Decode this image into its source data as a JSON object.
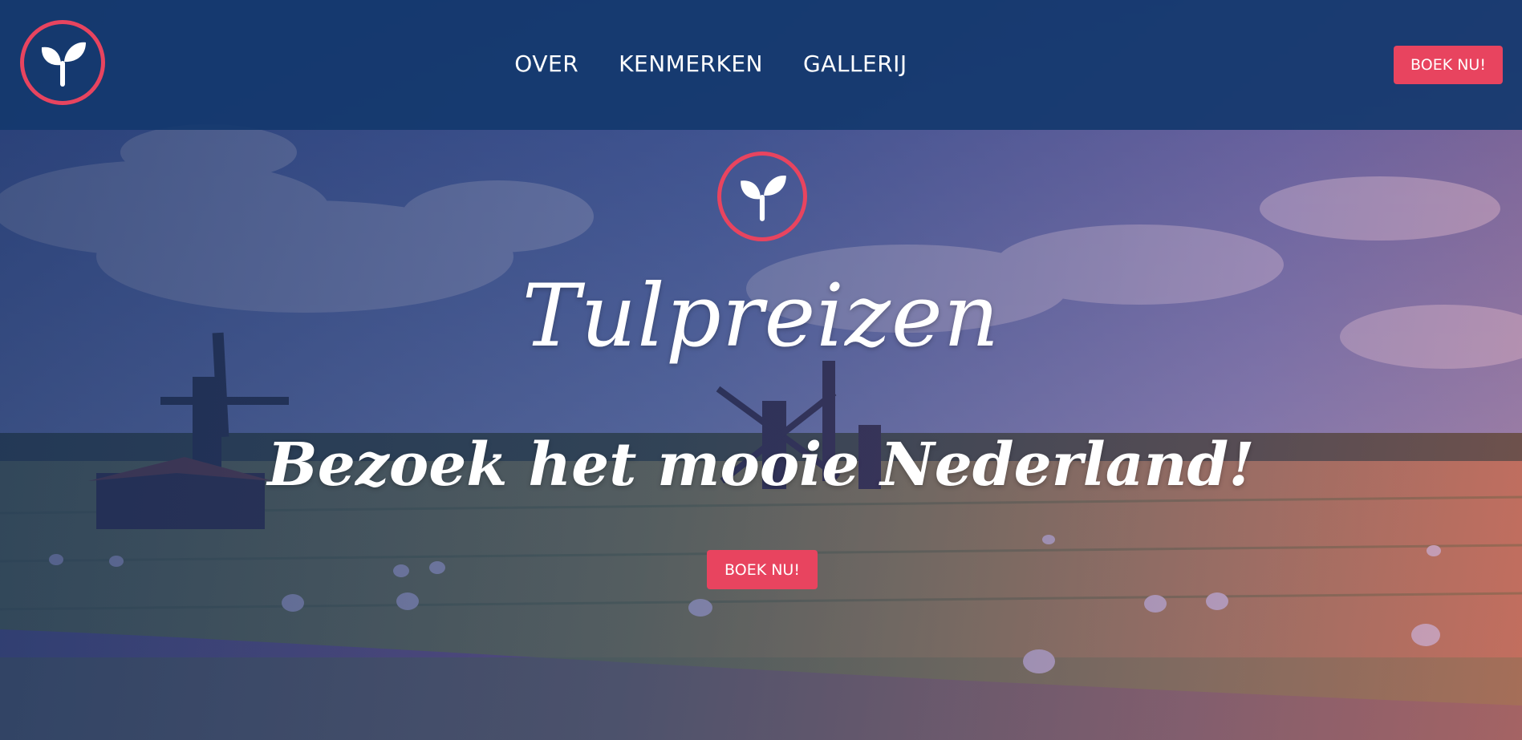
{
  "header": {
    "logo_icon": "sprout-icon",
    "nav": [
      {
        "label": "OVER"
      },
      {
        "label": "KENMERKEN"
      },
      {
        "label": "GALLERIJ"
      }
    ],
    "cta_label": "BOEK NU!"
  },
  "hero": {
    "logo_icon": "sprout-icon",
    "title": "Tulpreizen",
    "subtitle": "Bezoek het mooie Nederland!",
    "cta_label": "BOEK NU!",
    "background": "windmill-landscape-photo"
  },
  "colors": {
    "accent": "#e8445f",
    "navbar": "#14386e",
    "text": "#ffffff"
  }
}
